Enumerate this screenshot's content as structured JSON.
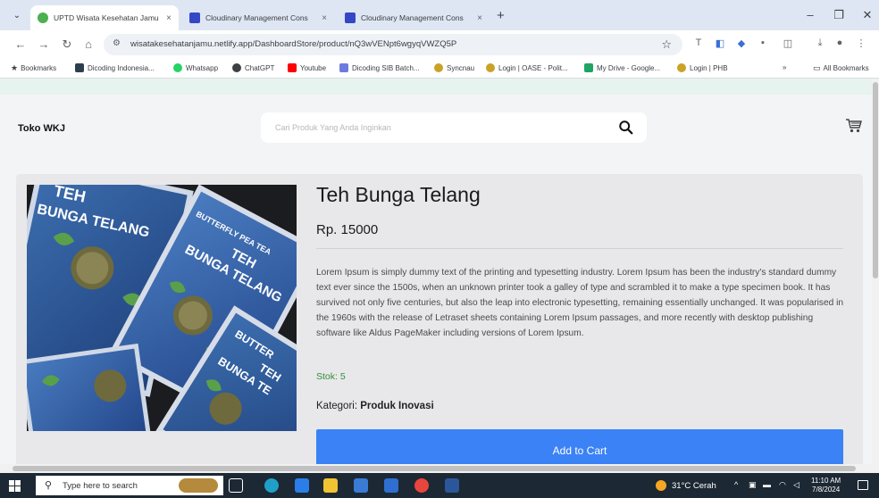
{
  "browser": {
    "tabs": [
      {
        "title": "UPTD Wisata Kesehatan Jamu",
        "active": true,
        "favicon_color": "#4caf50"
      },
      {
        "title": "Cloudinary Management Cons",
        "active": false,
        "favicon_color": "#3448c5"
      },
      {
        "title": "Cloudinary Management Cons",
        "active": false,
        "favicon_color": "#3448c5"
      }
    ],
    "new_tab_label": "+",
    "close_tab_label": "×",
    "url": "wisatakesehatanjamu.netlify.app/DashboardStore/product/nQ3wVENpt6wgyqVWZQ5P",
    "bookmarks": [
      {
        "label": "Bookmarks",
        "icon": "star-icon",
        "color": "#3c4043"
      },
      {
        "label": "Dicoding Indonesia...",
        "icon": "dicoding-icon",
        "color": "#2d3e50"
      },
      {
        "label": "Whatsapp",
        "icon": "whatsapp-icon",
        "color": "#25d366"
      },
      {
        "label": "ChatGPT",
        "icon": "chatgpt-icon",
        "color": "#3c4043"
      },
      {
        "label": "Youtube",
        "icon": "youtube-icon",
        "color": "#ff0000"
      },
      {
        "label": "Dicoding SIB Batch...",
        "icon": "sib-icon",
        "color": "#6c7ae0"
      },
      {
        "label": "Syncnau",
        "icon": "syncnau-icon",
        "color": "#c9a227"
      },
      {
        "label": "Login | OASE - Polit...",
        "icon": "oase-icon",
        "color": "#c9a227"
      },
      {
        "label": "My Drive - Google...",
        "icon": "drive-icon",
        "color": "#1fa463"
      },
      {
        "label": "Login | PHB",
        "icon": "phb-icon",
        "color": "#c9a227"
      }
    ],
    "bookmarks_more": "»",
    "all_bookmarks": "All Bookmarks"
  },
  "page": {
    "store_name": "Toko WKJ",
    "search_placeholder": "Cari Produk Yang Anda Inginkan",
    "product": {
      "name": "Teh Bunga Telang",
      "price": "Rp. 15000",
      "description": "Lorem Ipsum is simply dummy text of the printing and typesetting industry. Lorem Ipsum has been the industry's standard dummy text ever since the 1500s, when an unknown printer took a galley of type and scrambled it to make a type specimen book. It has survived not only five centuries, but also the leap into electronic typesetting, remaining essentially unchanged. It was popularised in the 1960s with the release of Letraset sheets containing Lorem Ipsum passages, and more recently with desktop publishing software like Aldus PageMaker including versions of Lorem Ipsum.",
      "stock": "Stok: 5",
      "category_label": "Kategori:",
      "category_value": "Produk Inovasi",
      "add_to_cart_label": "Add to Cart",
      "image_text": {
        "pack1_line1": "TEH",
        "pack1_line2": "BUNGA TELANG",
        "pack2_line1": "BUTTERFLY PEA TEA",
        "pack2_line2": "TEH",
        "pack2_line3": "BUNGA TELANG",
        "pack3_line1": "BUTTER",
        "pack3_line2": "TEH",
        "pack3_line3": "BUNGA TE"
      }
    },
    "colors": {
      "accent": "#3b82f6",
      "stock_green": "#2f8f3a"
    }
  },
  "taskbar": {
    "search_placeholder": "Type here to search",
    "weather": "31°C  Cerah",
    "time": "11:10 AM",
    "date": "7/8/2024",
    "tray_arrow": "^"
  }
}
